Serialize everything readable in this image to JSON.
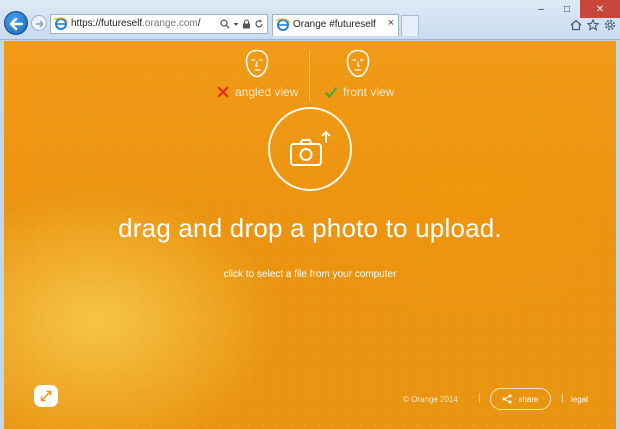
{
  "browser": {
    "url_prefix": "https://futureself",
    "url_domain": ".orange.com",
    "url_suffix": "/",
    "tab_title": "Orange #futureself",
    "tab_close": "×",
    "window_buttons": [
      "–",
      "□",
      "✕"
    ]
  },
  "page": {
    "views": {
      "angled": {
        "label": "angled view",
        "status": "incorrect"
      },
      "front": {
        "label": "front view",
        "status": "correct"
      }
    },
    "headline": "drag and drop a photo to upload.",
    "subline": "click to select a file from your computer",
    "footer": {
      "copyright": "© Orange 2014",
      "separator": "|",
      "share_label": "share",
      "legal_label": "legal"
    }
  },
  "colors": {
    "accent_orange": "#ee9513",
    "cross_red": "#e8261c",
    "check_green": "#3aa935",
    "chrome_blue": "#1b63b8"
  }
}
